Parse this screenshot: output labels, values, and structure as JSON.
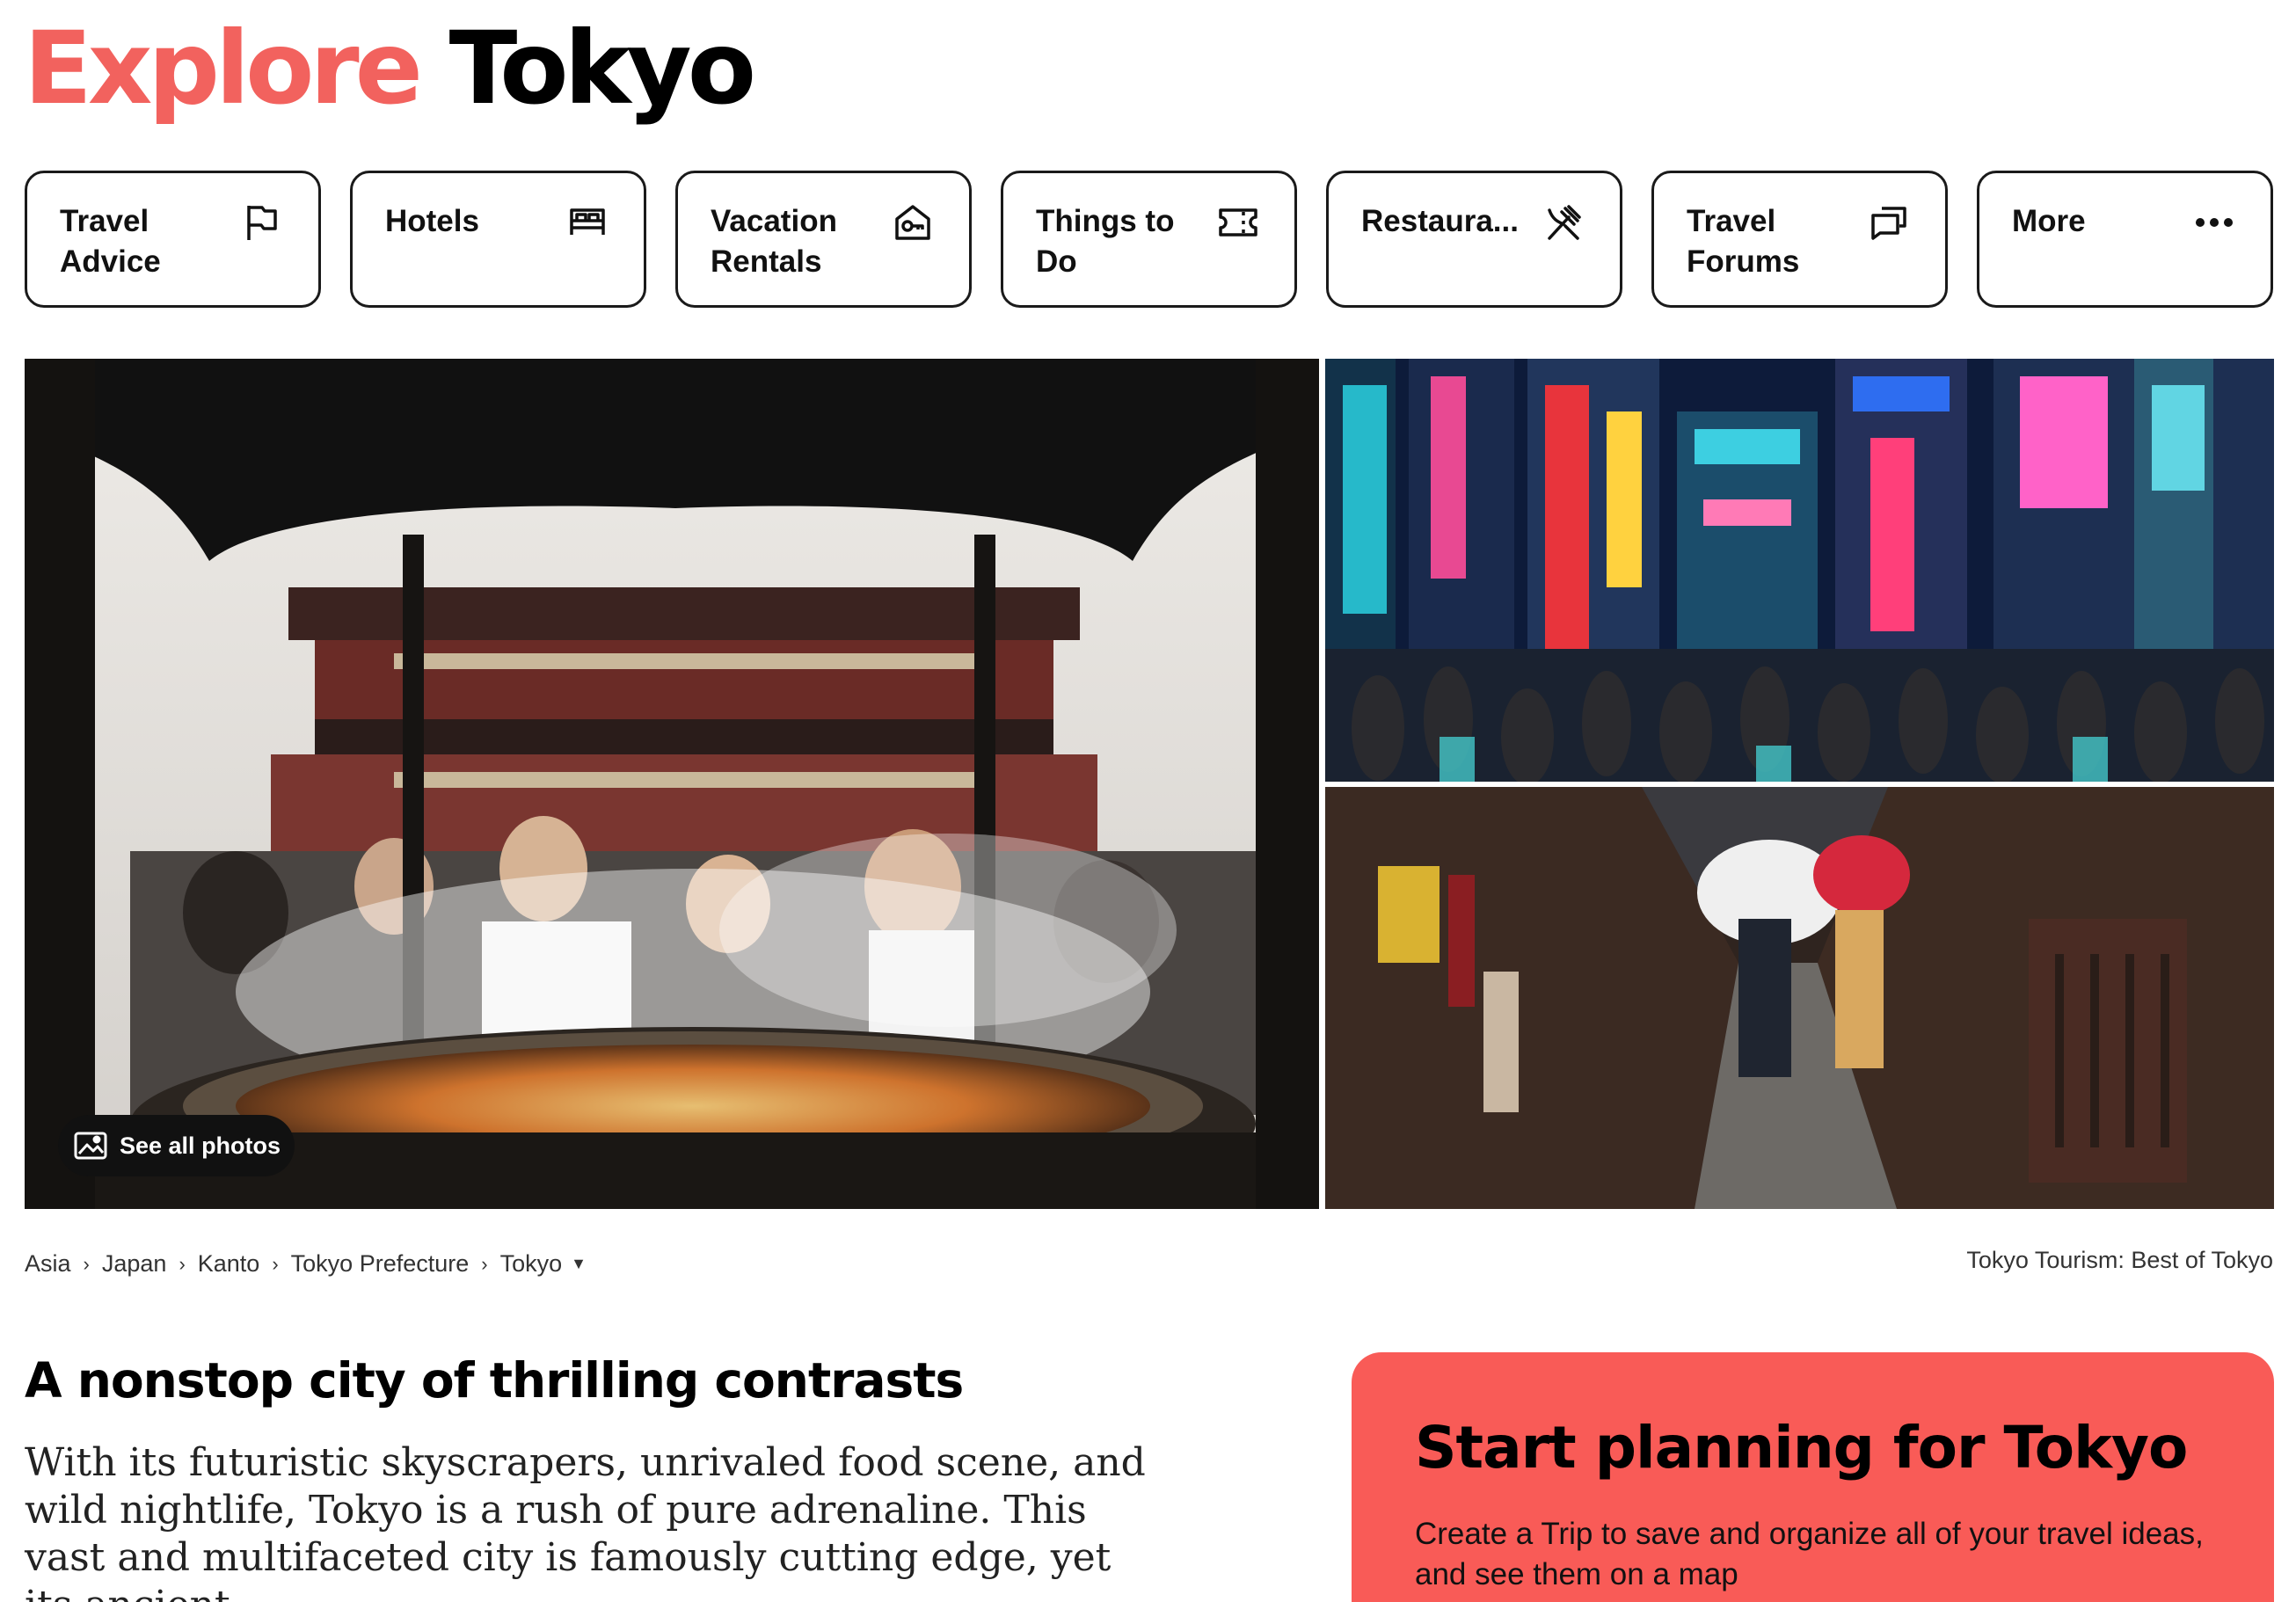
{
  "title": {
    "accent": "Explore",
    "city": "Tokyo"
  },
  "nav": [
    {
      "label": "Travel\nAdvice",
      "icon": "flag-icon"
    },
    {
      "label": "Hotels",
      "icon": "bed-icon"
    },
    {
      "label": "Vacation\nRentals",
      "icon": "house-key-icon"
    },
    {
      "label": "Things to\nDo",
      "icon": "ticket-icon"
    },
    {
      "label": "Restaura...",
      "icon": "fork-knife-icon"
    },
    {
      "label": "Travel\nForums",
      "icon": "chat-bubbles-icon"
    },
    {
      "label": "More",
      "icon": "ellipsis-icon"
    }
  ],
  "photos": {
    "see_all": "See all photos",
    "see_all_icon": "image-icon"
  },
  "breadcrumb": [
    "Asia",
    "Japan",
    "Kanto",
    "Tokyo Prefecture",
    "Tokyo"
  ],
  "tourism_label": "Tokyo Tourism: Best of Tokyo",
  "article": {
    "headline": "A nonstop city of thrilling contrasts",
    "intro": "With its futuristic skyscrapers, unrivaled food scene, and wild nightlife, Tokyo is a rush of pure adrenaline. This vast and multifaceted city is famously cutting edge, yet its ancient"
  },
  "plan_card": {
    "title": "Start planning for Tokyo",
    "text": "Create a Trip to save and organize all of your travel ideas, and see them on a map"
  },
  "colors": {
    "brand": "#f2625e",
    "card": "#f95b57",
    "text": "#000000"
  }
}
